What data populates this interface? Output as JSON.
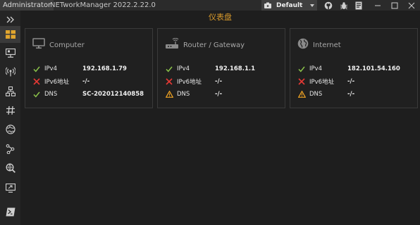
{
  "titlebar": {
    "user": "Administrator",
    "app_title": "NETworkManager 2022.2.22.0",
    "profile": "Default"
  },
  "colors": {
    "accent": "#d99a2b",
    "ok": "#8bc34a",
    "error": "#e53935",
    "warning": "#f5a623"
  },
  "sidebar": {
    "items": [
      {
        "icon": "chevron-double-right-icon"
      },
      {
        "icon": "dashboard-icon"
      },
      {
        "icon": "network-interface-icon"
      },
      {
        "icon": "wifi-icon"
      },
      {
        "icon": "ip-scanner-icon"
      },
      {
        "icon": "port-scanner-icon"
      },
      {
        "icon": "ping-monitor-icon"
      },
      {
        "icon": "traceroute-icon"
      },
      {
        "icon": "dns-lookup-icon"
      },
      {
        "icon": "remote-desktop-icon"
      },
      {
        "icon": "powershell-icon"
      }
    ]
  },
  "main": {
    "title": "仪表盘",
    "cards": [
      {
        "title": "Computer",
        "icon": "computer-icon",
        "rows": [
          {
            "status": "ok",
            "key": "IPv4",
            "value": "192.168.1.79"
          },
          {
            "status": "error",
            "key": "IPv6地址",
            "value": "-/-"
          },
          {
            "status": "ok",
            "key": "DNS",
            "value": "SC-202012140858"
          }
        ]
      },
      {
        "title": "Router / Gateway",
        "icon": "router-icon",
        "rows": [
          {
            "status": "ok",
            "key": "IPv4",
            "value": "192.168.1.1"
          },
          {
            "status": "error",
            "key": "IPv6地址",
            "value": "-/-"
          },
          {
            "status": "warning",
            "key": "DNS",
            "value": "-/-"
          }
        ]
      },
      {
        "title": "Internet",
        "icon": "globe-icon",
        "rows": [
          {
            "status": "ok",
            "key": "IPv4",
            "value": "182.101.54.160"
          },
          {
            "status": "error",
            "key": "IPv6地址",
            "value": "-/-"
          },
          {
            "status": "warning",
            "key": "DNS",
            "value": "-/-"
          }
        ]
      }
    ]
  }
}
